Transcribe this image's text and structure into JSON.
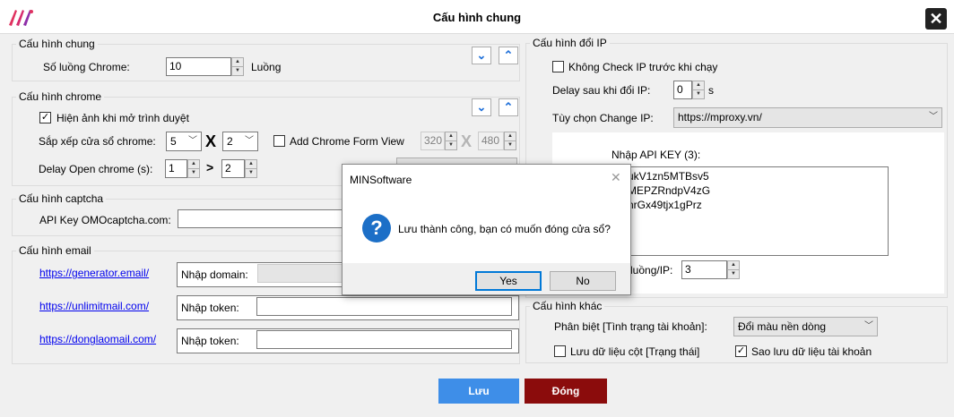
{
  "window": {
    "title": "Cấu hình chung",
    "close_glyph": "✕",
    "logo_icon": "minsoftware-logo"
  },
  "general": {
    "title": "Cấu hình chung",
    "chrome_count_label": "Số luồng Chrome:",
    "chrome_count_value": "10",
    "threads_unit": "Luồng"
  },
  "chrome": {
    "title": "Cấu hình chrome",
    "show_image_label": "Hiện ảnh khi mở trình duyệt",
    "show_image_checked": true,
    "arrange_label": "Sắp xếp cửa sổ chrome:",
    "arrange_cols": "5",
    "arrange_times": "X",
    "arrange_rows": "2",
    "add_form_view_label": "Add Chrome Form View",
    "add_form_view_checked": false,
    "form_width": "320",
    "form_times": "X",
    "form_height": "480",
    "delay_label": "Delay Open chrome (s):",
    "delay_from": "1",
    "delay_gt": ">",
    "delay_to": "2"
  },
  "captcha": {
    "title": "Cấu hình captcha",
    "api_key_label": "API Key OMOcaptcha.com:",
    "api_key_value": ""
  },
  "email": {
    "title": "Cấu hình email",
    "rows": [
      {
        "link": "https://generator.email/",
        "field_label": "Nhập domain:",
        "value": ""
      },
      {
        "link": "https://unlimitmail.com/",
        "field_label": "Nhập token:",
        "value": ""
      },
      {
        "link": "https://donglaomail.com/",
        "field_label": "Nhập token:",
        "value": ""
      }
    ]
  },
  "ip": {
    "title": "Cấu hình đổi IP",
    "no_check_label": "Không Check IP trước khi chạy",
    "no_check_checked": false,
    "delay_label": "Delay sau khi đổi IP:",
    "delay_value": "0",
    "delay_unit": "s",
    "option_label": "Tùy chọn Change IP:",
    "option_value": "https://mproxy.vn/",
    "api_key_label": "Nhập API KEY (3):",
    "api_keys": [
      "ukV1zn5MTBsv5",
      "MEPZRndpV4zG",
      "nrGx49tjx1gPrz"
    ],
    "threads_per_ip_label": "luồng/IP:",
    "threads_per_ip_value": "3"
  },
  "other": {
    "title": "Cấu hình khác",
    "distinguish_label": "Phân biệt [Tình trạng tài khoản]:",
    "distinguish_value": "Đổi màu nền dòng",
    "save_column_label": "Lưu dữ liệu cột [Trạng thái]",
    "save_column_checked": false,
    "backup_label": "Sao lưu dữ liệu tài khoản",
    "backup_checked": true
  },
  "buttons": {
    "save": "Lưu",
    "close": "Đóng"
  },
  "dialog": {
    "title": "MINSoftware",
    "message": "Lưu thành công, bạn có muốn đóng cửa sổ?",
    "yes": "Yes",
    "no": "No",
    "icon": "question-icon"
  },
  "colors": {
    "primary": "#3e8ee8",
    "danger": "#8b0c0c",
    "accent": "#1e6fd9"
  }
}
